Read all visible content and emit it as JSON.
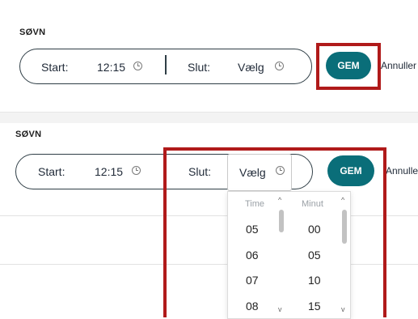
{
  "panel1": {
    "section_title": "SØVN",
    "start_label": "Start:",
    "start_value": "12:15",
    "end_label": "Slut:",
    "end_value": "Vælg",
    "save_label": "GEM",
    "cancel_label": "Annuller"
  },
  "panel2": {
    "section_title": "SØVN",
    "start_label": "Start:",
    "start_value": "12:15",
    "end_label": "Slut:",
    "end_value": "Vælg",
    "save_label": "GEM",
    "cancel_label": "Annuller",
    "picker": {
      "hour_header": "Time",
      "minute_header": "Minut",
      "hours": [
        "05",
        "06",
        "07",
        "08"
      ],
      "minutes": [
        "00",
        "05",
        "10",
        "15"
      ]
    }
  },
  "colors": {
    "accent": "#0a6e79",
    "highlight": "#b01a1a"
  },
  "icons": [
    "clock-icon",
    "chevron-up-icon",
    "chevron-down-icon"
  ]
}
